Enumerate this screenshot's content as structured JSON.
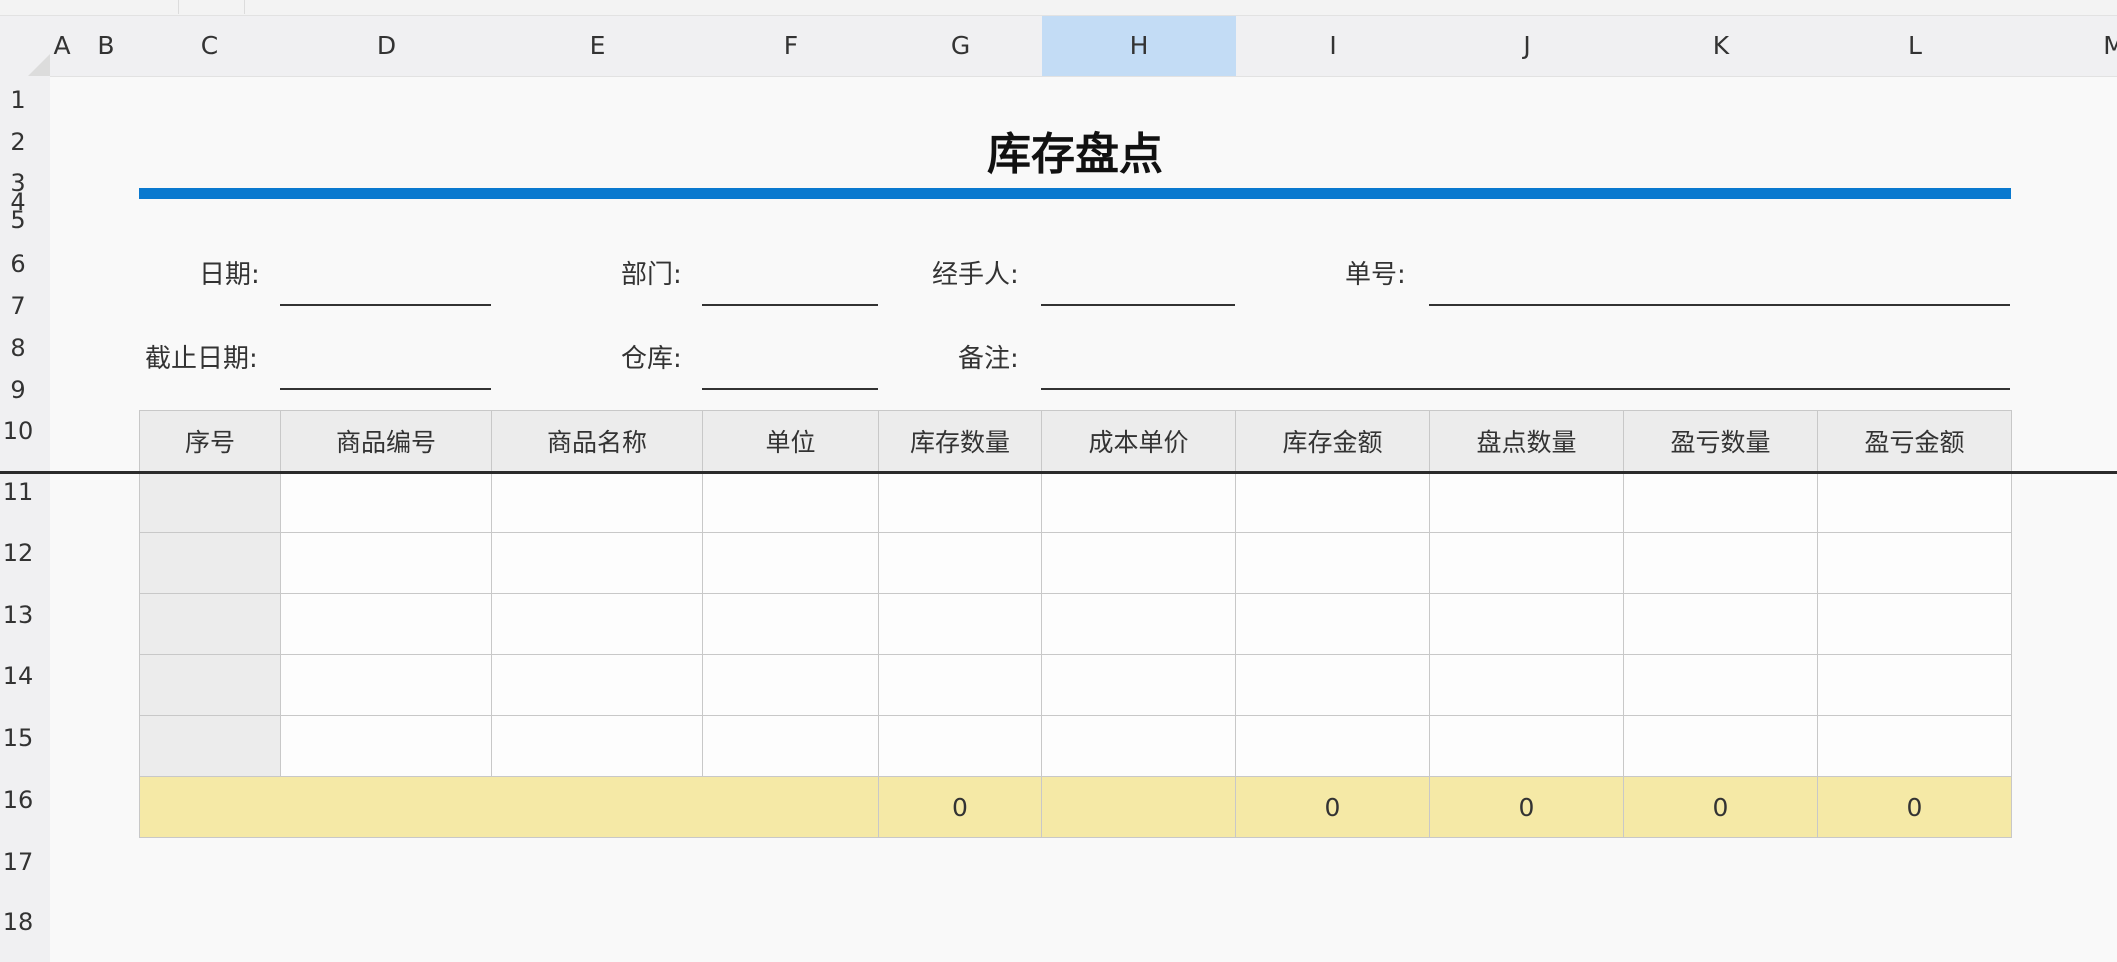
{
  "sheet": {
    "columns": [
      {
        "label": "A",
        "w": 24
      },
      {
        "label": "B",
        "w": 64
      },
      {
        "label": "C",
        "w": 143
      },
      {
        "label": "D",
        "w": 211
      },
      {
        "label": "E",
        "w": 211
      },
      {
        "label": "F",
        "w": 176
      },
      {
        "label": "G",
        "w": 163
      },
      {
        "label": "H",
        "w": 194,
        "selected": true
      },
      {
        "label": "I",
        "w": 194
      },
      {
        "label": "J",
        "w": 194
      },
      {
        "label": "K",
        "w": 194
      },
      {
        "label": "L",
        "w": 194
      },
      {
        "label": "M",
        "w": 204
      }
    ],
    "rows": [
      "1",
      "2",
      "3",
      "4",
      "5",
      "6",
      "7",
      "8",
      "9",
      "10",
      "11",
      "12",
      "13",
      "14",
      "15",
      "16",
      "17",
      "18"
    ],
    "selected_color": "#c3dcf5"
  },
  "document": {
    "title": "库存盘点",
    "accent_color": "#0a79cf",
    "fields_row1": {
      "date_label": "日期:",
      "dept_label": "部门:",
      "handler_label": "经手人:",
      "number_label": "单号:"
    },
    "fields_row2": {
      "cutoff_label": "截止日期:",
      "warehouse_label": "仓库:",
      "remark_label": "备注:"
    }
  },
  "table": {
    "headers": [
      "序号",
      "商品编号",
      "商品名称",
      "单位",
      "库存数量",
      "成本单价",
      "库存金额",
      "盘点数量",
      "盈亏数量",
      "盈亏金额"
    ],
    "totals": [
      "",
      "",
      "",
      "",
      "0",
      "",
      "0",
      "0",
      "0",
      "0"
    ],
    "total_color": "#f5e9a6"
  }
}
